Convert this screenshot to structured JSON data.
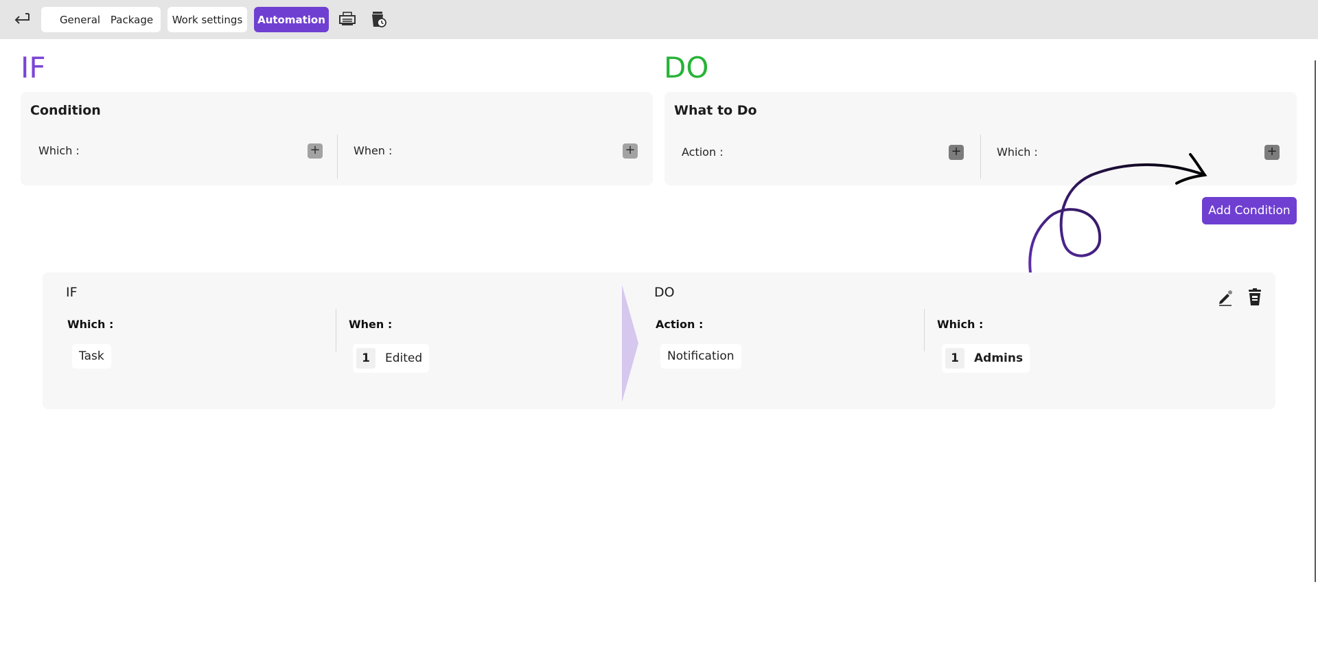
{
  "toolbar": {
    "back_icon": "return-arrow-icon",
    "tabs": [
      {
        "label": "General",
        "active": false
      },
      {
        "label": "Package",
        "active": false
      },
      {
        "label": "Work settings",
        "active": false
      },
      {
        "label": "Automation",
        "active": true
      }
    ],
    "icons": [
      "print-icon",
      "trash-clock-icon"
    ]
  },
  "if_section": {
    "heading": "IF",
    "panel_title": "Condition",
    "fields": [
      {
        "label": "Which :"
      },
      {
        "label": "When :"
      }
    ]
  },
  "do_section": {
    "heading": "DO",
    "panel_title": "What to Do",
    "fields": [
      {
        "label": "Action :"
      },
      {
        "label": "Which :"
      }
    ]
  },
  "add_condition_label": "Add Condition",
  "rule": {
    "if_heading": "IF",
    "do_heading": "DO",
    "which_label": "Which :",
    "which_value": "Task",
    "when_label": "When :",
    "when_count": "1",
    "when_value": "Edited",
    "action_label": "Action :",
    "action_value": "Notification",
    "do_which_label": "Which :",
    "do_which_count": "1",
    "do_which_value": "Admins",
    "icons": [
      "edit-icon",
      "delete-icon"
    ]
  },
  "colors": {
    "accent": "#6f3fd1",
    "if_heading": "#7b45d6",
    "do_heading": "#27b337",
    "panel_bg": "#f7f7f7",
    "toolbar_bg": "#e5e5e5"
  }
}
